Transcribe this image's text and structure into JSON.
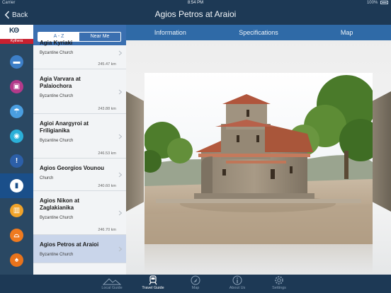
{
  "status": {
    "carrier": "Carrier",
    "time": "8:54 PM",
    "battery": "100%"
  },
  "navbar": {
    "back_label": "Back",
    "title": "Agios Petros at Araioi"
  },
  "brand": {
    "logo_text": "ΚΘ",
    "name": "Kythera"
  },
  "categories": [
    {
      "icon": "bed-icon",
      "color": "#3d7fc8"
    },
    {
      "icon": "bus-icon",
      "color": "#b33a8a"
    },
    {
      "icon": "beach-umbrella-icon",
      "color": "#4a9ee0"
    },
    {
      "icon": "eye-icon",
      "color": "#2bb0d9"
    },
    {
      "icon": "exclamation-icon",
      "color": "#2c5fa8"
    },
    {
      "icon": "column-icon",
      "color": "#1a4f8a"
    },
    {
      "icon": "city-icon",
      "color": "#f0a32a"
    },
    {
      "icon": "parachute-icon",
      "color": "#ef7a1f"
    },
    {
      "icon": "helmet-icon",
      "color": "#e8731c"
    }
  ],
  "segmented": {
    "left": "A - Z",
    "right": "Near Me"
  },
  "list": [
    {
      "name": "Agia Kyriaki",
      "type": "Byzantine Church",
      "distance": "245.47 km"
    },
    {
      "name": "Agia Varvara at Palaiochora",
      "type": "Byzantine Church",
      "distance": "243.88 km"
    },
    {
      "name": "Agioi Anargyroi at Friligianika",
      "type": "Byzantine Church",
      "distance": "246.53 km"
    },
    {
      "name": "Agios Georgios Vounou",
      "type": "Church",
      "distance": "240.60 km"
    },
    {
      "name": "Agios Nikon at Zaglakianika",
      "type": "Byzantine Church",
      "distance": "246.70 km"
    },
    {
      "name": "Agios Petros at Araioi",
      "type": "Byzantine Church",
      "distance": ""
    }
  ],
  "tabs": [
    "Information",
    "Specifications",
    "Map"
  ],
  "tabbar": [
    "Local Guide",
    "Travel Guide",
    "Map",
    "About Us",
    "Settings"
  ]
}
